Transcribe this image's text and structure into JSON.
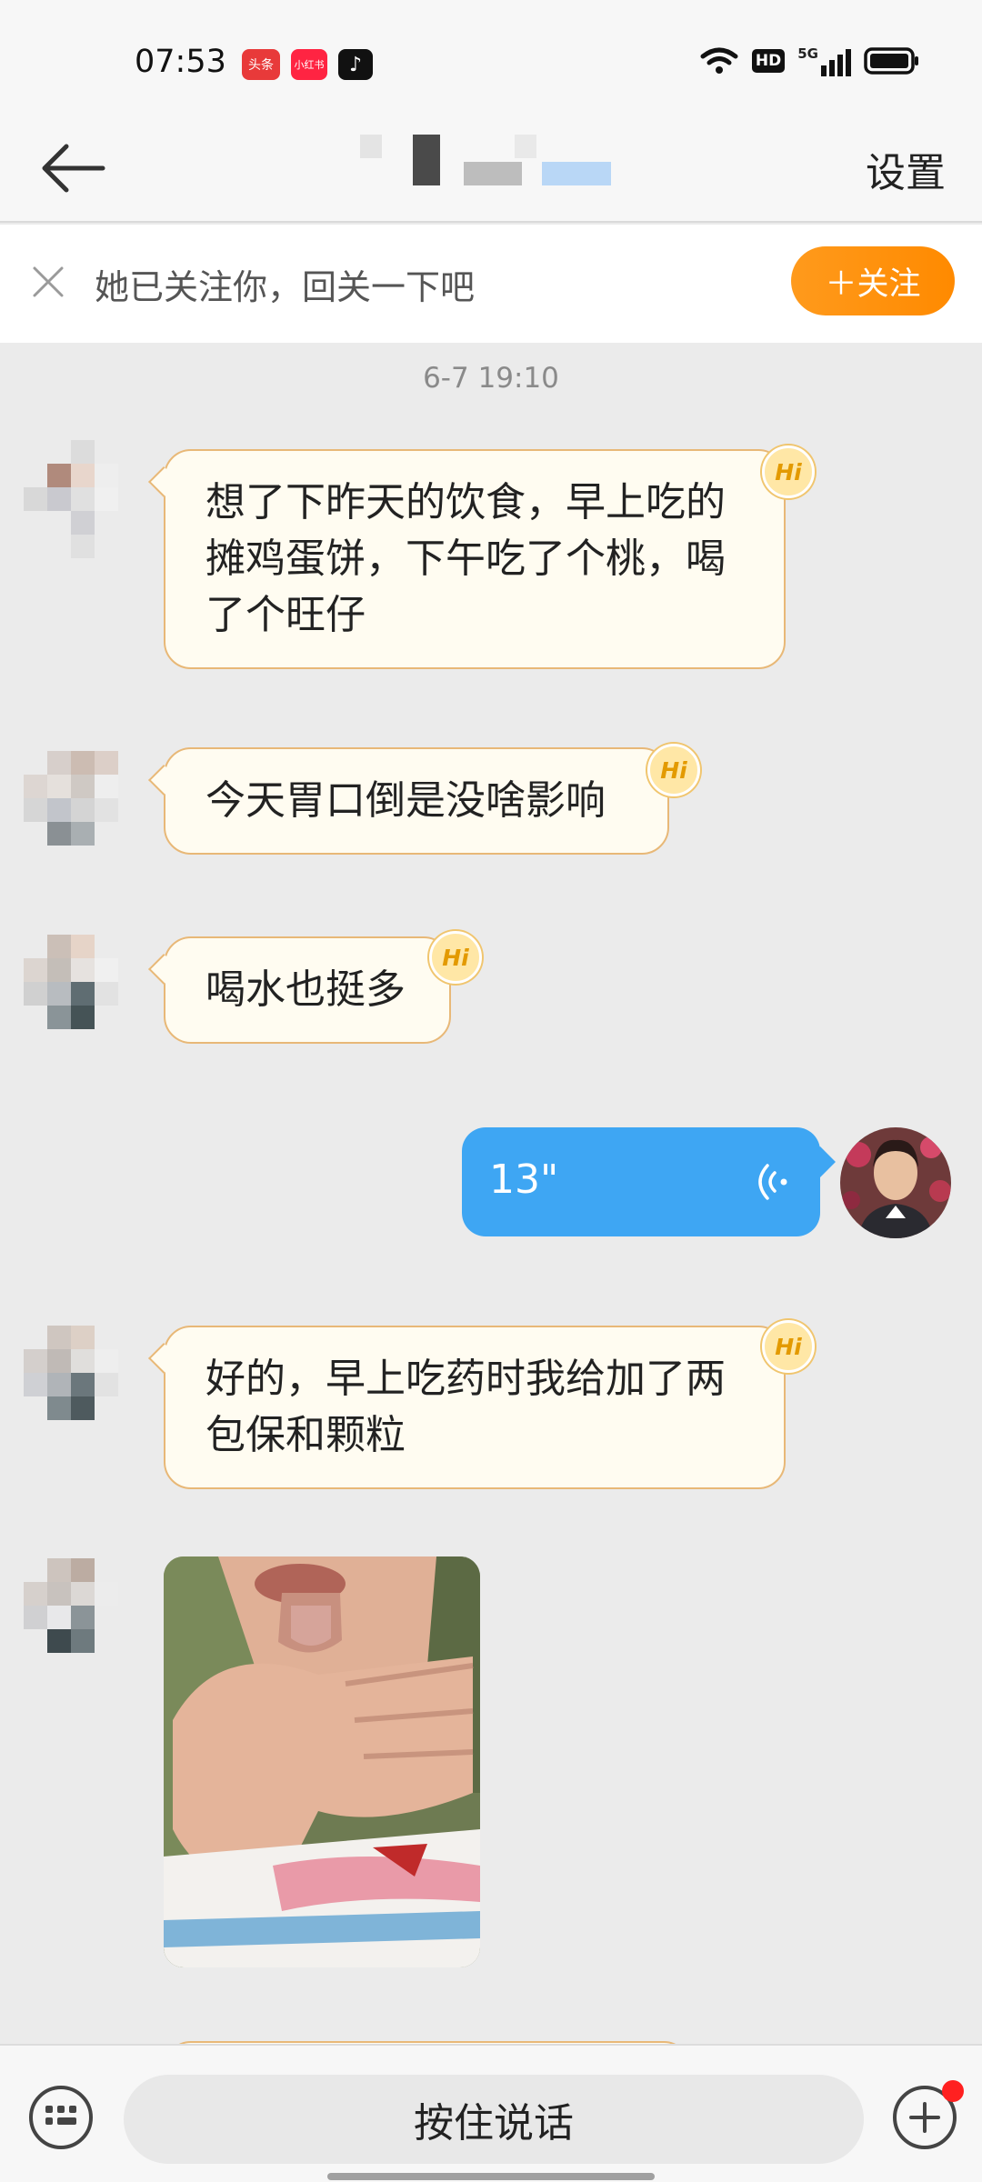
{
  "status_bar": {
    "time": "07:53",
    "app_badges": [
      {
        "label": "头条",
        "color": "#e83a3a"
      },
      {
        "label": "小红书",
        "color": "#ff2442"
      },
      {
        "label": "♪",
        "color": "#111111"
      }
    ],
    "hd_label": "HD",
    "network_label": "5G"
  },
  "nav": {
    "settings_label": "设置"
  },
  "follow_bar": {
    "text": "她已关注你，回关一下吧",
    "follow_label": "＋关注"
  },
  "chat": {
    "timestamp": "6-7 19:10",
    "hi_label": "Hi",
    "messages": [
      {
        "text": "想了下昨天的饮食，早上吃的摊鸡蛋饼，下午吃了个桃，喝了个旺仔"
      },
      {
        "text": "今天胃口倒是没啥影响"
      },
      {
        "text": "喝水也挺多"
      },
      {
        "text": "好的，早上吃药时我给加了两包保和颗粒"
      }
    ],
    "voice": {
      "duration": "13\""
    }
  },
  "input_bar": {
    "hold_to_talk_label": "按住说话"
  },
  "colors": {
    "accent_orange": "#ff9a1c",
    "voice_blue": "#3ea6f3",
    "bubble_border": "#e8b877"
  }
}
